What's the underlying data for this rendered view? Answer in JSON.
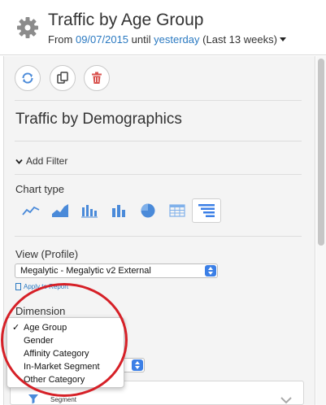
{
  "header": {
    "title": "Traffic by Age Group",
    "from_label": "From",
    "start_date": "09/07/2015",
    "until_label": "until",
    "end_date": "yesterday",
    "range_note": "(Last 13 weeks)"
  },
  "toolbar": {
    "refresh_icon": "refresh-icon",
    "copy_icon": "copy-icon",
    "delete_icon": "trash-icon"
  },
  "widget": {
    "name": "Traffic by Demographics",
    "add_filter": "Add Filter"
  },
  "chart_type": {
    "label": "Chart type",
    "options": [
      "line",
      "area",
      "column",
      "bar",
      "pie",
      "table",
      "funnel"
    ],
    "selected": "funnel"
  },
  "view": {
    "label": "View (Profile)",
    "value": "Megalytic - Megalytic v2 External",
    "apply_to_report": "Apply to Report"
  },
  "dimension": {
    "label": "Dimension",
    "selected": "Age Group",
    "options": [
      "Age Group",
      "Gender",
      "Affinity Category",
      "In-Market Segment",
      "Other Category"
    ]
  },
  "segment": {
    "label": "Segment"
  },
  "colors": {
    "accent": "#2a79c1",
    "icon_blue": "#4a8ad9",
    "highlight_red": "#d62027",
    "delete_red": "#d9534f"
  }
}
